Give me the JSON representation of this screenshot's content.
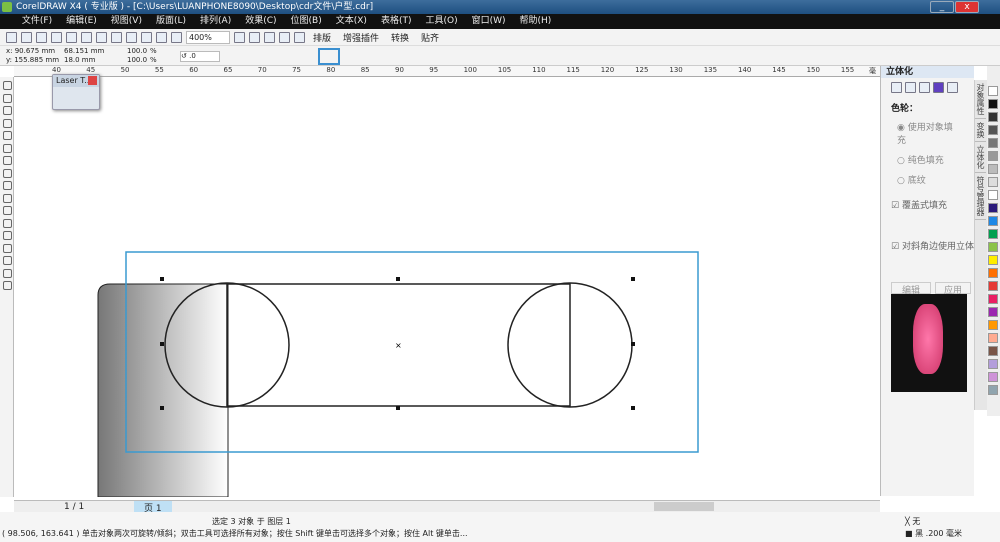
{
  "window": {
    "title": "CorelDRAW X4 ( 专业版 ) - [C:\\Users\\LUANPHONE8090\\Desktop\\cdr文件\\户型.cdr]"
  },
  "menu": [
    "文件(F)",
    "编辑(E)",
    "视图(V)",
    "版面(L)",
    "排列(A)",
    "效果(C)",
    "位图(B)",
    "文本(X)",
    "表格(T)",
    "工具(O)",
    "窗口(W)",
    "帮助(H)"
  ],
  "toolbar": {
    "zoom": "400%",
    "plugins": [
      "排版",
      "增强插件",
      "转换",
      "贴齐"
    ]
  },
  "property_bar": {
    "x": "x: 90.675 mm",
    "y": "y: 155.885 mm",
    "width": "68.151 mm",
    "height": "18.0 mm",
    "scale_x": "100.0",
    "scale_y": "100.0",
    "pct": "%",
    "rotation": ".0"
  },
  "ruler": {
    "labels": [
      "40",
      "45",
      "50",
      "55",
      "60",
      "65",
      "70",
      "75",
      "80",
      "85",
      "90",
      "95",
      "100",
      "105",
      "110",
      "115",
      "120",
      "125",
      "130",
      "135",
      "140",
      "145",
      "150",
      "155"
    ],
    "unit": "毫米"
  },
  "laser_tool": {
    "title": "Laser T..."
  },
  "docker": {
    "title": "立体化",
    "section": "色轮：",
    "options": [
      "使用对象填充",
      "纯色填充",
      "底纹"
    ],
    "selected_option": 0,
    "checkbox1": "覆盖式填充",
    "checkbox2": "对斜角边使用立体填充",
    "edit": "编辑",
    "apply": "应用",
    "side_tabs": [
      "对象属性",
      "变换",
      "立体化",
      "符号管理器"
    ]
  },
  "palette_colors": [
    "#ffffff",
    "#111111",
    "#333333",
    "#555555",
    "#777777",
    "#999999",
    "#bbbbbb",
    "#dddddd",
    "#ffffff",
    "#2a1a7a",
    "#1e88e5",
    "#00a050",
    "#8bc34a",
    "#ffee00",
    "#ff6f00",
    "#e53935",
    "#e91e63",
    "#9c27b0",
    "#ff9800",
    "#ffab91",
    "#795548",
    "#b39ddb",
    "#ce93d8",
    "#90a4ae"
  ],
  "pagebar": {
    "page_count": "1 / 1",
    "page_tab": "页 1"
  },
  "status": {
    "selection": "选定 3 对象 于 图层 1",
    "hint": "( 98.506, 163.641 ) 单击对象两次可旋转/倾斜；双击工具可选择所有对象；按住 Shift 键单击可选择多个对象；按住 Alt 键单击...",
    "fill": "无",
    "outline": "黑 .200 毫米"
  }
}
